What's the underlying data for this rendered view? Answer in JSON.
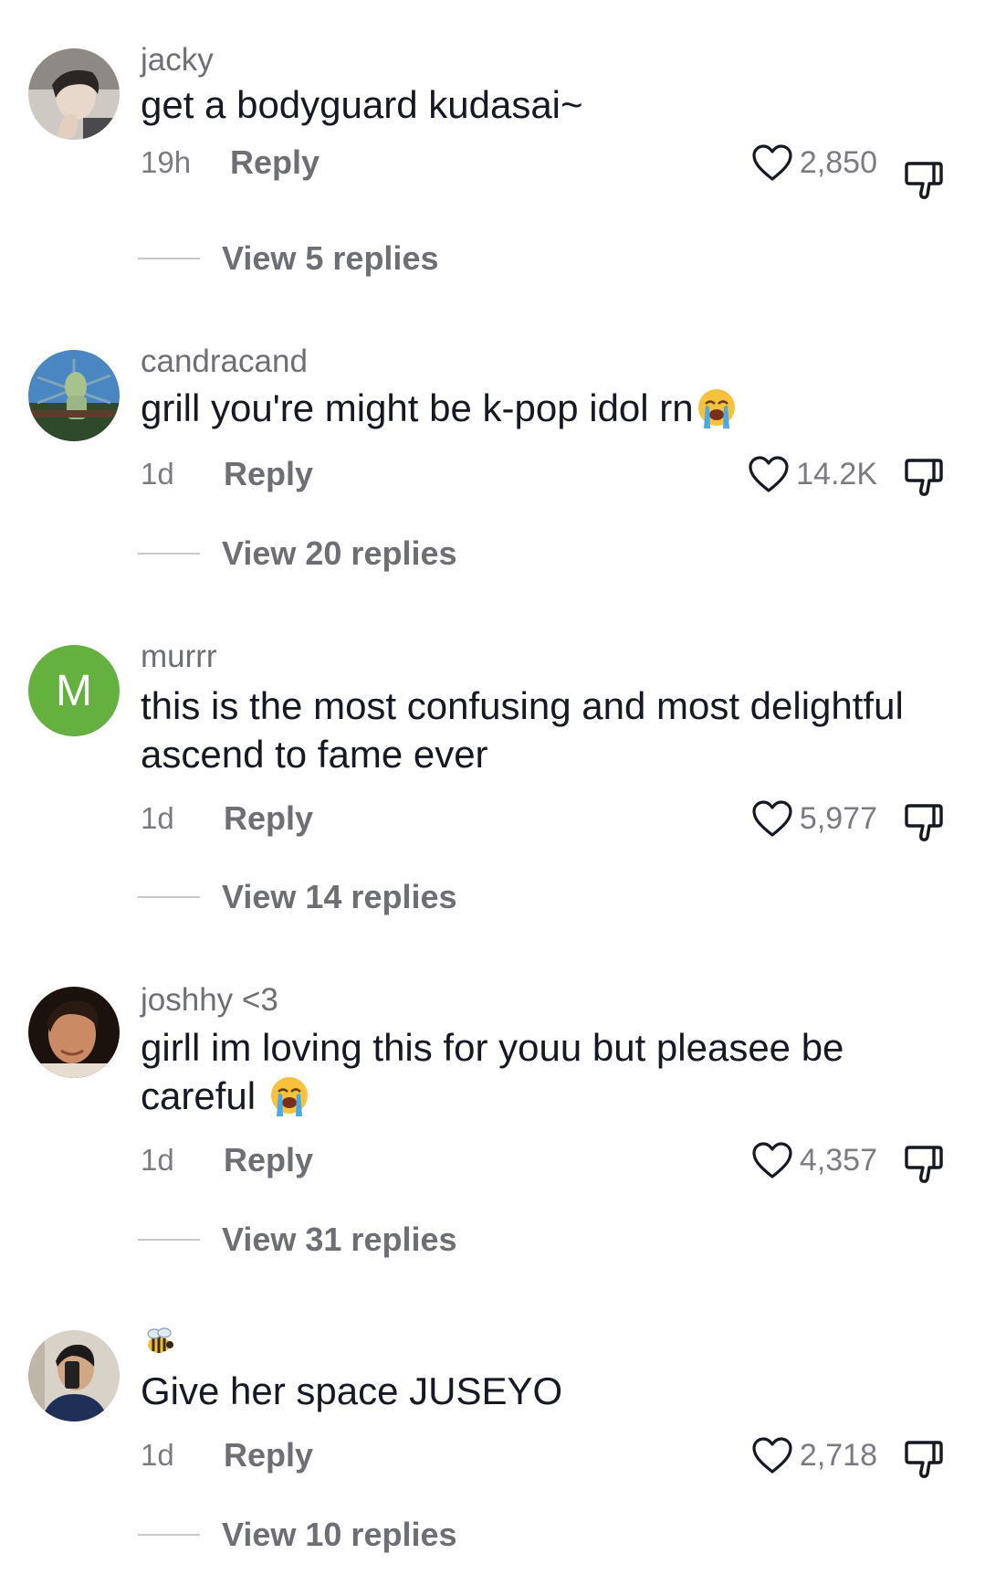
{
  "comments": [
    {
      "username": "jacky",
      "text": "get a bodyguard kudasai~",
      "time": "19h",
      "reply_label": "Reply",
      "likes": "2,850",
      "view_replies": "View 5 replies",
      "avatar": "photo-person-hand-on-chin"
    },
    {
      "username": "candracand",
      "text": "grill you're might be k-pop idol rn",
      "emoji": "loudly-crying-face",
      "time": "1d",
      "reply_label": "Reply",
      "likes": "14.2K",
      "view_replies": "View 20 replies",
      "avatar": "cartoon-squidward"
    },
    {
      "username": "murrr",
      "text_line1": "this is the most confusing and most delightful",
      "text_line2": "ascend to fame ever",
      "avatar_letter": "M",
      "avatar_color": "#65b13f",
      "time": "1d",
      "reply_label": "Reply",
      "likes": "5,977",
      "view_replies": "View 14 replies"
    },
    {
      "username": "joshhy <3",
      "text_line1": "girll im loving this for youu but pleasee be",
      "text_line2": "careful",
      "emoji": "loudly-crying-face",
      "time": "1d",
      "reply_label": "Reply",
      "likes": "4,357",
      "view_replies": "View 31 replies",
      "avatar": "photo-young-man-portrait"
    },
    {
      "username_icon": "bee-icon",
      "text": "Give her space JUSEYO",
      "time": "1d",
      "reply_label": "Reply",
      "likes": "2,718",
      "view_replies": "View 10 replies",
      "avatar": "photo-mirror-selfie"
    }
  ],
  "colors": {
    "text_primary": "#161823",
    "text_secondary": "#7b7c82",
    "avatar_green": "#65b13f",
    "divider": "#c8c8cc"
  }
}
